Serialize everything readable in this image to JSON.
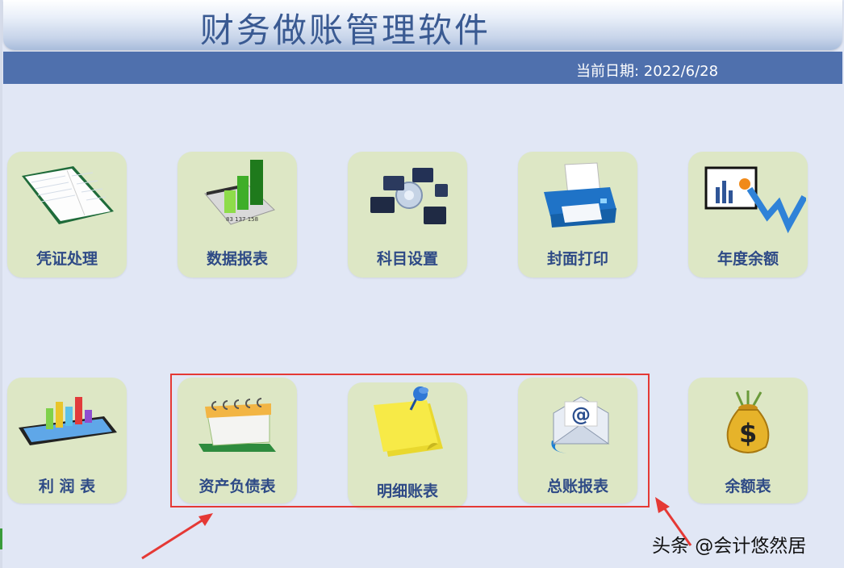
{
  "app": {
    "title": "财务做账管理软件",
    "date_text": "当前日期:  2022/6/28"
  },
  "tiles": {
    "voucher": {
      "label": "凭证处理",
      "icon": "ledger-book-icon"
    },
    "data_report": {
      "label": "数据报表",
      "icon": "bar-chart-numbers-icon"
    },
    "subject_settings": {
      "label": "科目设置",
      "icon": "network-settings-icon"
    },
    "cover_print": {
      "label": "封面打印",
      "icon": "printer-icon"
    },
    "annual_balance": {
      "label": "年度余额",
      "icon": "trend-presentation-icon"
    },
    "profit": {
      "label": "利 润 表",
      "icon": "3d-bar-chart-icon"
    },
    "balance_sheet": {
      "label": "资产负债表",
      "icon": "calendar-icon"
    },
    "detail_ledger": {
      "label": "明细账表",
      "icon": "pinned-note-icon"
    },
    "general_ledger": {
      "label": "总账报表",
      "icon": "email-at-icon"
    },
    "balance_table": {
      "label": "余额表",
      "icon": "money-bag-icon"
    }
  },
  "watermark": "头条 @会计悠然居",
  "colors": {
    "background": "#e1e7f5",
    "title_text": "#3a5a92",
    "date_bar": "#4f70ad",
    "tile_bg": "#dde7c5",
    "tile_label": "#2e4a86",
    "highlight": "#e53935"
  }
}
